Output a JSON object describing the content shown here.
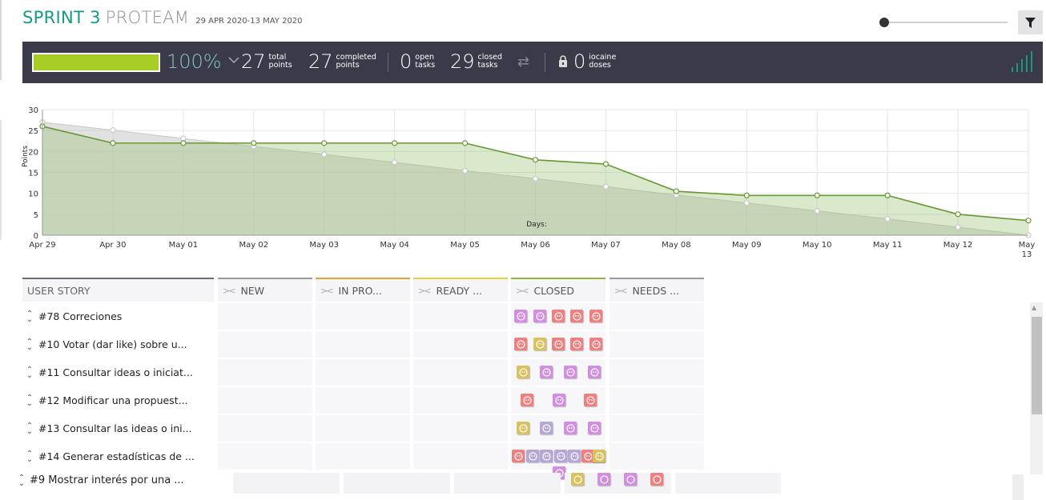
{
  "header": {
    "sprint": "SPRINT 3",
    "team": "PROTEAM",
    "dates": "29 APR 2020-13 MAY 2020"
  },
  "stats": {
    "progress_percent": 100,
    "percent_label": "100%",
    "total_points": {
      "num": "27",
      "l1": "total",
      "l2": "points"
    },
    "completed_points": {
      "num": "27",
      "l1": "completed",
      "l2": "points"
    },
    "open_tasks": {
      "num": "0",
      "l1": "open",
      "l2": "tasks"
    },
    "closed_tasks": {
      "num": "29",
      "l1": "closed",
      "l2": "tasks"
    },
    "iocaine": {
      "num": "0",
      "l1": "iocaine",
      "l2": "doses"
    }
  },
  "chart_data": {
    "type": "area",
    "xlabel": "Days",
    "ylabel": "Points",
    "ylim": [
      0,
      30
    ],
    "yticks": [
      "0",
      "5",
      "10",
      "15",
      "20",
      "25",
      "30"
    ],
    "categories": [
      "Apr 29",
      "Apr 30",
      "May 01",
      "May 02",
      "May 03",
      "May 04",
      "May 05",
      "May 06",
      "May 07",
      "May 08",
      "May 09",
      "May 10",
      "May 11",
      "May 12",
      "May 13"
    ],
    "series": [
      {
        "values": [
          27,
          25.1,
          23.1,
          21.2,
          19.3,
          17.4,
          15.4,
          13.5,
          11.6,
          9.6,
          7.7,
          5.8,
          3.9,
          1.9,
          0
        ],
        "color": "#c8c8c8"
      },
      {
        "values": [
          26,
          22,
          22,
          22,
          22,
          22,
          22,
          18,
          17,
          10.5,
          9.5,
          9.5,
          9.5,
          5,
          3.5
        ],
        "color": "#669933"
      }
    ]
  },
  "board": {
    "user_story_header": "USER STORY",
    "columns": [
      {
        "name": "NEW",
        "color": "#9a9a9a"
      },
      {
        "name": "IN PRO...",
        "color": "#e8a13a"
      },
      {
        "name": "READY ...",
        "color": "#e6d13d"
      },
      {
        "name": "CLOSED",
        "color": "#8ab83c"
      },
      {
        "name": "NEEDS ...",
        "color": "#9a9a9a"
      }
    ],
    "rows": [
      {
        "label": "#78 Correciones"
      },
      {
        "label": "#10 Votar (dar like) sobre u..."
      },
      {
        "label": "#11 Consultar ideas o iniciat..."
      },
      {
        "label": "#12 Modificar una propuest..."
      },
      {
        "label": "#13 Consultar las ideas o ini..."
      },
      {
        "label": "#14 Generar estadísticas de ..."
      }
    ],
    "partial_row": {
      "label": "#9 Mostrar interés por una ..."
    }
  },
  "colors": {
    "pink": "#f08080",
    "purple": "#d28ee0",
    "yellow": "#d9c25e",
    "lavender": "#b5a8d8"
  }
}
